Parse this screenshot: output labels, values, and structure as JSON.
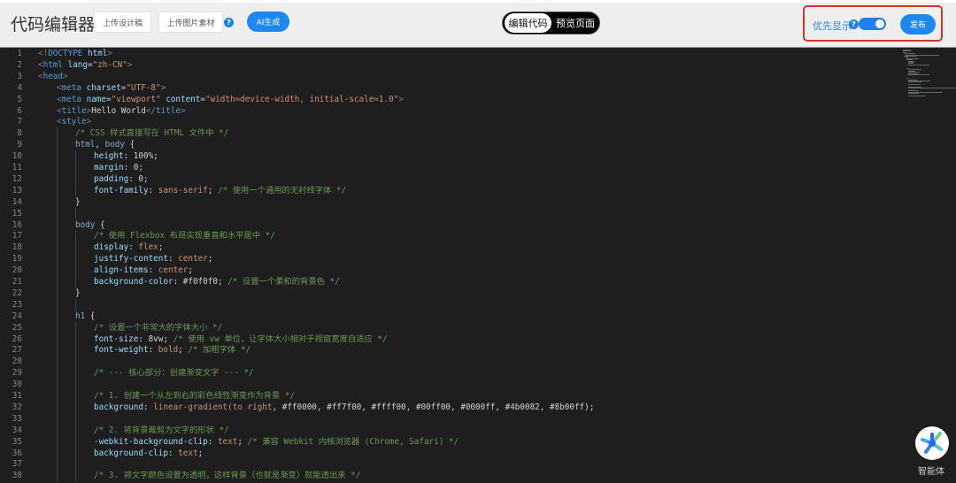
{
  "header": {
    "title": "代码编辑器",
    "upload_design": "上传设计稿",
    "upload_image": "上传图片素材",
    "help": "?",
    "ai_generate": "AI生成",
    "tabs": [
      {
        "label": "编辑代码",
        "active": true
      },
      {
        "label": "预览页面",
        "active": false
      }
    ],
    "priority_label": "优先显示",
    "priority_on": true,
    "publish": "发布"
  },
  "colors": {
    "accent": "#1e88f0",
    "highlight_box": "#d0362b",
    "editor_bg": "#1e1e1e"
  },
  "agent": {
    "label": "智能体",
    "icon": "agent-icon"
  },
  "editor": {
    "lines": [
      {
        "i": 0,
        "t": [
          [
            "g",
            "<!"
          ],
          [
            "t",
            "DOCTYPE"
          ],
          [
            "d",
            " "
          ],
          [
            "a",
            "html"
          ],
          [
            "g",
            ">"
          ]
        ]
      },
      {
        "i": 0,
        "t": [
          [
            "g",
            "<"
          ],
          [
            "t",
            "html"
          ],
          [
            "d",
            " "
          ],
          [
            "a",
            "lang"
          ],
          [
            "d",
            "="
          ],
          [
            "s",
            "\"zh-CN\""
          ],
          [
            "g",
            ">"
          ]
        ]
      },
      {
        "i": 0,
        "t": [
          [
            "g",
            "<"
          ],
          [
            "t",
            "head"
          ],
          [
            "g",
            ">"
          ]
        ]
      },
      {
        "i": 1,
        "t": [
          [
            "g",
            "<"
          ],
          [
            "t",
            "meta"
          ],
          [
            "d",
            " "
          ],
          [
            "a",
            "charset"
          ],
          [
            "d",
            "="
          ],
          [
            "s",
            "\"UTF-8\""
          ],
          [
            "g",
            ">"
          ]
        ]
      },
      {
        "i": 1,
        "t": [
          [
            "g",
            "<"
          ],
          [
            "t",
            "meta"
          ],
          [
            "d",
            " "
          ],
          [
            "a",
            "name"
          ],
          [
            "d",
            "="
          ],
          [
            "s",
            "\"viewport\""
          ],
          [
            "d",
            " "
          ],
          [
            "a",
            "content"
          ],
          [
            "d",
            "="
          ],
          [
            "s",
            "\"width=device-width, initial-scale=1.0\""
          ],
          [
            "g",
            ">"
          ]
        ]
      },
      {
        "i": 1,
        "t": [
          [
            "g",
            "<"
          ],
          [
            "t",
            "title"
          ],
          [
            "g",
            ">"
          ],
          [
            "d",
            "Hello World"
          ],
          [
            "g",
            "</"
          ],
          [
            "t",
            "title"
          ],
          [
            "g",
            ">"
          ]
        ]
      },
      {
        "i": 1,
        "t": [
          [
            "g",
            "<"
          ],
          [
            "t",
            "style"
          ],
          [
            "g",
            ">"
          ]
        ]
      },
      {
        "i": 2,
        "t": [
          [
            "c",
            "/* CSS 样式直接写在 HTML 文件中 */"
          ]
        ]
      },
      {
        "i": 2,
        "t": [
          [
            "sel",
            "html"
          ],
          [
            "d",
            ", "
          ],
          [
            "sel",
            "body"
          ],
          [
            "d",
            " {"
          ]
        ]
      },
      {
        "i": 3,
        "t": [
          [
            "p",
            "height"
          ],
          [
            "d",
            ": 100%;"
          ]
        ]
      },
      {
        "i": 3,
        "t": [
          [
            "p",
            "margin"
          ],
          [
            "d",
            ": 0;"
          ]
        ]
      },
      {
        "i": 3,
        "t": [
          [
            "p",
            "padding"
          ],
          [
            "d",
            ": 0;"
          ]
        ]
      },
      {
        "i": 3,
        "t": [
          [
            "p",
            "font-family"
          ],
          [
            "d",
            ": "
          ],
          [
            "v",
            "sans-serif"
          ],
          [
            "d",
            "; "
          ],
          [
            "c",
            "/* 使用一个通用的无衬线字体 */"
          ]
        ]
      },
      {
        "i": 2,
        "t": [
          [
            "d",
            "}"
          ]
        ]
      },
      {
        "i": 0,
        "t": []
      },
      {
        "i": 2,
        "t": [
          [
            "sel",
            "body"
          ],
          [
            "d",
            " {"
          ]
        ]
      },
      {
        "i": 3,
        "t": [
          [
            "c",
            "/* 使用 Flexbox 布局实现垂直和水平居中 */"
          ]
        ]
      },
      {
        "i": 3,
        "t": [
          [
            "p",
            "display"
          ],
          [
            "d",
            ": "
          ],
          [
            "v",
            "flex"
          ],
          [
            "d",
            ";"
          ]
        ]
      },
      {
        "i": 3,
        "t": [
          [
            "p",
            "justify-content"
          ],
          [
            "d",
            ": "
          ],
          [
            "v",
            "center"
          ],
          [
            "d",
            ";"
          ]
        ]
      },
      {
        "i": 3,
        "t": [
          [
            "p",
            "align-items"
          ],
          [
            "d",
            ": "
          ],
          [
            "v",
            "center"
          ],
          [
            "d",
            ";"
          ]
        ]
      },
      {
        "i": 3,
        "t": [
          [
            "p",
            "background-color"
          ],
          [
            "d",
            ": #f0f0f0; "
          ],
          [
            "c",
            "/* 设置一个柔和的背景色 */"
          ]
        ]
      },
      {
        "i": 2,
        "t": [
          [
            "d",
            "}"
          ]
        ]
      },
      {
        "i": 0,
        "t": []
      },
      {
        "i": 2,
        "t": [
          [
            "sel",
            "h1"
          ],
          [
            "d",
            " {"
          ]
        ]
      },
      {
        "i": 3,
        "t": [
          [
            "c",
            "/* 设置一个非常大的字体大小 */"
          ]
        ]
      },
      {
        "i": 3,
        "t": [
          [
            "p",
            "font-size"
          ],
          [
            "d",
            ": 8vw; "
          ],
          [
            "c",
            "/* 使用 vw 单位，让字体大小相对于视窗宽度自适应 */"
          ]
        ]
      },
      {
        "i": 3,
        "t": [
          [
            "p",
            "font-weight"
          ],
          [
            "d",
            ": "
          ],
          [
            "v",
            "bold"
          ],
          [
            "d",
            "; "
          ],
          [
            "c",
            "/* 加粗字体 */"
          ]
        ]
      },
      {
        "i": 0,
        "t": []
      },
      {
        "i": 3,
        "t": [
          [
            "c",
            "/* --- 核心部分：创建渐变文字 --- */"
          ]
        ]
      },
      {
        "i": 0,
        "t": []
      },
      {
        "i": 3,
        "t": [
          [
            "c",
            "/* 1. 创建一个从左到右的彩色线性渐变作为背景 */"
          ]
        ]
      },
      {
        "i": 3,
        "t": [
          [
            "p",
            "background"
          ],
          [
            "d",
            ": "
          ],
          [
            "v",
            "linear-gradient(to right"
          ],
          [
            "d",
            ", #ff0000, #ff7f00, #ffff00, #00ff00, #0000ff, #4b0082, #8b00ff);"
          ]
        ]
      },
      {
        "i": 0,
        "t": []
      },
      {
        "i": 3,
        "t": [
          [
            "c",
            "/* 2. 将背景裁剪为文字的形状 */"
          ]
        ]
      },
      {
        "i": 3,
        "t": [
          [
            "p",
            "-webkit-background-clip"
          ],
          [
            "d",
            ": "
          ],
          [
            "v",
            "text"
          ],
          [
            "d",
            "; "
          ],
          [
            "c",
            "/* 兼容 Webkit 内核浏览器 (Chrome, Safari) */"
          ]
        ]
      },
      {
        "i": 3,
        "t": [
          [
            "p",
            "background-clip"
          ],
          [
            "d",
            ": "
          ],
          [
            "v",
            "text"
          ],
          [
            "d",
            ";"
          ]
        ]
      },
      {
        "i": 0,
        "t": []
      },
      {
        "i": 3,
        "t": [
          [
            "c",
            "/* 3. 将文字颜色设置为透明，这样背景（也就是渐变）就能透出来 */"
          ]
        ]
      }
    ]
  }
}
